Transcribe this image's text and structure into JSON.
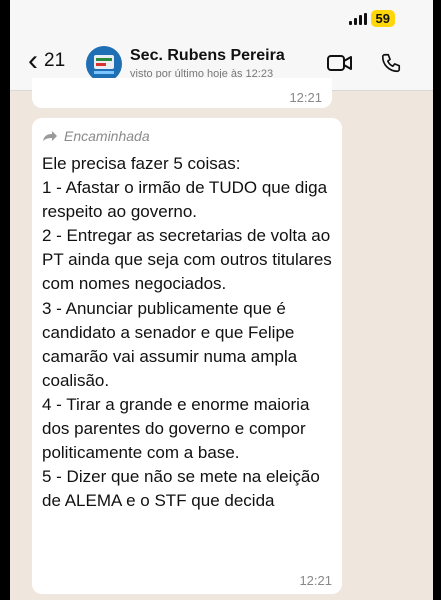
{
  "status_bar": {
    "battery": "59"
  },
  "header": {
    "back_count": "21",
    "contact_name": "Sec. Rubens Pereira",
    "contact_status": "visto por último hoje às 12:23"
  },
  "messages": [
    {
      "time": "12:21"
    },
    {
      "forwarded_label": "Encaminhada",
      "text": "Ele precisa fazer 5 coisas:\n1 - Afastar o irmão de TUDO que diga respeito ao governo.\n2 - Entregar as secretarias de volta ao PT ainda que seja com outros titulares com nomes negociados.\n3 - Anunciar publicamente que é candidato a senador e que Felipe camarão vai assumir numa ampla coalisão.\n4 - Tirar a grande e enorme maioria dos parentes do governo e compor politicamente com a base.\n5 - Dizer que não se mete na eleição de ALEMA e o STF que decida",
      "time": "12:21"
    }
  ]
}
